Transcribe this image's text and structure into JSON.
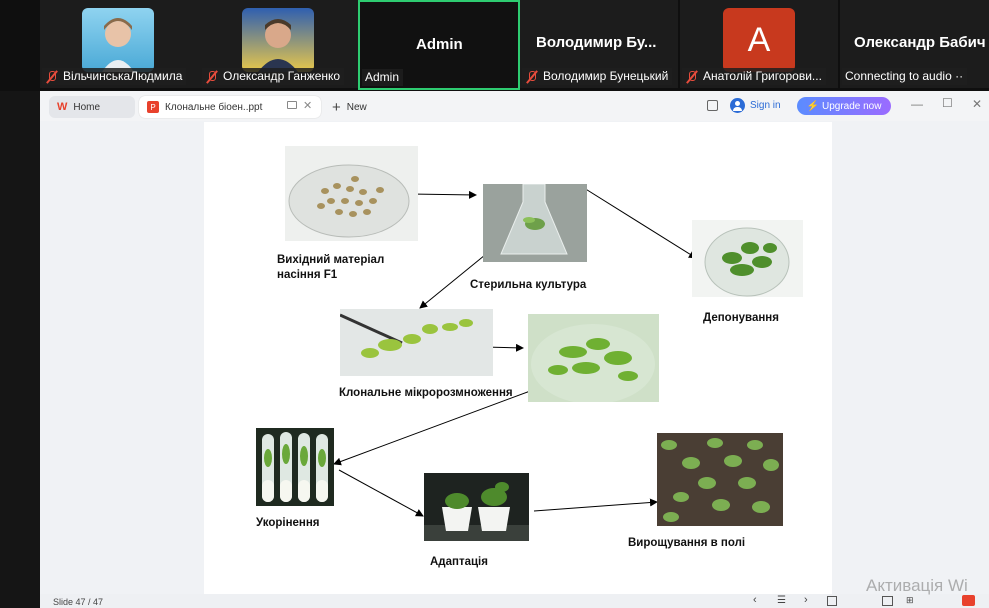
{
  "participants": [
    {
      "name": "ВільчинськаЛюдмила",
      "muted": true
    },
    {
      "name": "Олександр Ганженко",
      "muted": true
    },
    {
      "name": "Admin",
      "title": "Admin",
      "muted": false
    },
    {
      "name": "Володимир Бунецький",
      "title": "Володимир  Бу...",
      "muted": true
    },
    {
      "name": "Анатолій Григорови...",
      "initial": "A",
      "muted": true
    },
    {
      "name": "Connecting to audio ··",
      "title": "Олександр Бабич",
      "muted": false
    }
  ],
  "app": {
    "tabs": {
      "home": "Home",
      "doc": "Клональне  біоен..ppt"
    },
    "new_tab": "New",
    "sign_in": "Sign in",
    "upgrade": "Upgrade now"
  },
  "slide": {
    "labels": {
      "source_1": "Вихідний матеріал",
      "source_2": "насіння F1",
      "sterile": "Стерильна культура",
      "deposit": "Депонування",
      "micro": "Клональне мікророзмноження",
      "rooting": "Укорінення",
      "adaptation": "Адаптація",
      "field": "Вирощування в полі"
    }
  },
  "status": {
    "slide_counter": "Slide 47 / 47"
  },
  "watermark": "Активація Wi",
  "colors": {
    "active_speaker": "#2ecc71",
    "accent": "#2b6bd6",
    "wps_red": "#e8412c",
    "avatar_orange": "#c8391e"
  }
}
